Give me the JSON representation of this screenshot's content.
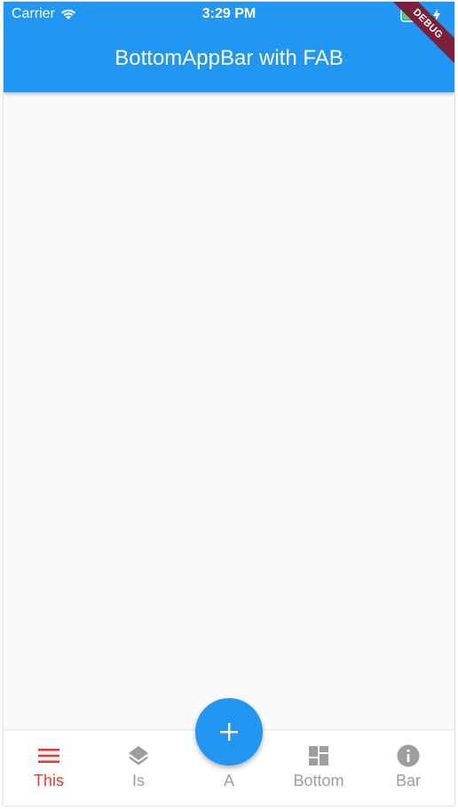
{
  "status_bar": {
    "carrier": "Carrier",
    "time": "3:29 PM"
  },
  "app_bar": {
    "title": "BottomAppBar with FAB",
    "debug_banner": "DEBUG"
  },
  "colors": {
    "primary": "#2196f3",
    "active": "#e53935",
    "inactive": "#9e9e9e",
    "background": "#fafafa"
  },
  "fab": {
    "icon": "plus-icon"
  },
  "bottom_nav": {
    "items": [
      {
        "label": "This",
        "icon": "menu-icon",
        "active": true
      },
      {
        "label": "Is",
        "icon": "layers-icon",
        "active": false
      },
      {
        "label": "A",
        "icon": "",
        "active": false
      },
      {
        "label": "Bottom",
        "icon": "dashboard-icon",
        "active": false
      },
      {
        "label": "Bar",
        "icon": "info-icon",
        "active": false
      }
    ]
  }
}
